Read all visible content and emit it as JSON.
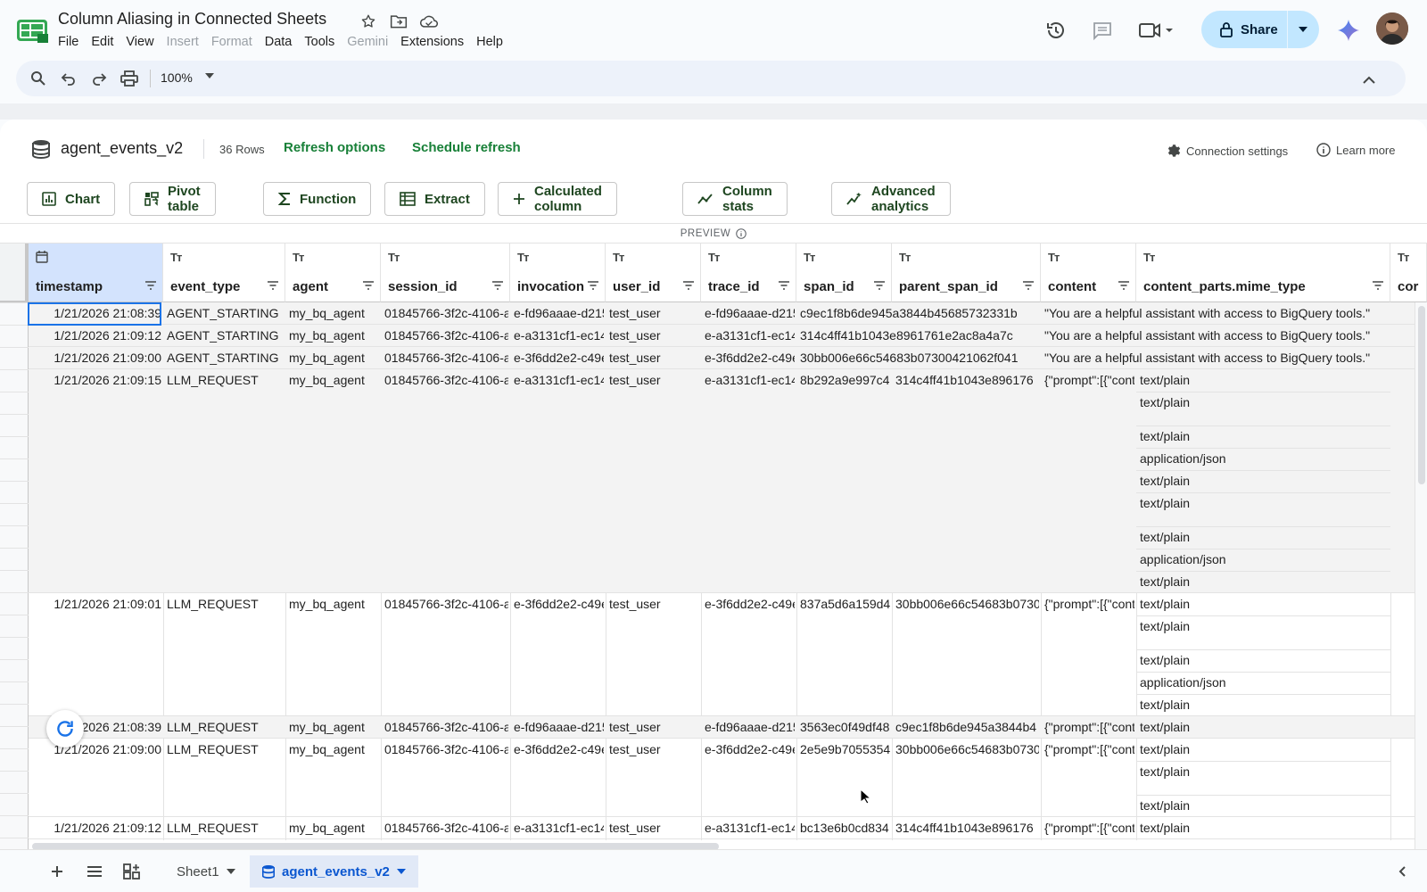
{
  "app": {
    "doc_title": "Column Aliasing in Connected Sheets",
    "menus": [
      {
        "label": "File",
        "disabled": false
      },
      {
        "label": "Edit",
        "disabled": false
      },
      {
        "label": "View",
        "disabled": false
      },
      {
        "label": "Insert",
        "disabled": true
      },
      {
        "label": "Format",
        "disabled": true
      },
      {
        "label": "Data",
        "disabled": false
      },
      {
        "label": "Tools",
        "disabled": false
      },
      {
        "label": "Gemini",
        "disabled": true
      },
      {
        "label": "Extensions",
        "disabled": false
      },
      {
        "label": "Help",
        "disabled": false
      }
    ],
    "share_label": "Share",
    "colors": {
      "accent": "#188038",
      "share_bg": "#c2e7ff",
      "selection": "#1a73e8"
    }
  },
  "toolbar": {
    "zoom": "100%"
  },
  "datasource": {
    "name": "agent_events_v2",
    "rows": "36 Rows",
    "refresh_options": "Refresh options",
    "schedule_refresh": "Schedule refresh",
    "connection_settings": "Connection settings",
    "learn_more": "Learn more",
    "preview_label": "PREVIEW"
  },
  "actions": [
    {
      "label": "Chart",
      "icon": "chart-icon"
    },
    {
      "label": "Pivot table",
      "icon": "pivot-icon"
    },
    {
      "label": "Function",
      "icon": "sigma-icon"
    },
    {
      "label": "Extract",
      "icon": "table-icon"
    },
    {
      "label": "Calculated column",
      "icon": "plus-icon"
    },
    {
      "label": "Column stats",
      "icon": "stats-icon"
    },
    {
      "label": "Advanced analytics",
      "icon": "analytics-icon"
    }
  ],
  "columns": [
    {
      "name": "timestamp",
      "type": "calendar"
    },
    {
      "name": "event_type",
      "type": "Tт"
    },
    {
      "name": "agent",
      "type": "Tт"
    },
    {
      "name": "session_id",
      "type": "Tт"
    },
    {
      "name": "invocation",
      "type": "Tт"
    },
    {
      "name": "user_id",
      "type": "Tт"
    },
    {
      "name": "trace_id",
      "type": "Tт"
    },
    {
      "name": "span_id",
      "type": "Tт"
    },
    {
      "name": "parent_span_id",
      "type": "Tт"
    },
    {
      "name": "content",
      "type": "Tт"
    },
    {
      "name": "content_parts.mime_type",
      "type": "Tт"
    },
    {
      "name": "cor",
      "type": "Tт"
    }
  ],
  "rows": [
    {
      "timestamp": "1/21/2026 21:08:39",
      "event_type": "AGENT_STARTING",
      "agent": "my_bq_agent",
      "session_id": "01845766-3f2c-4106-a",
      "invocation": "e-fd96aaae-d215",
      "user_id": "test_user",
      "trace_id": "e-fd96aaae-d215",
      "span_id": "c9ec1f8b6de945a3844b45685732331b",
      "parent_span_id": "",
      "content": "\"You are a helpful assistant with access to BigQuery tools.\"",
      "mime": []
    },
    {
      "timestamp": "1/21/2026 21:09:12",
      "event_type": "AGENT_STARTING",
      "agent": "my_bq_agent",
      "session_id": "01845766-3f2c-4106-a",
      "invocation": "e-a3131cf1-ec14",
      "user_id": "test_user",
      "trace_id": "e-a3131cf1-ec14",
      "span_id": "314c4ff41b1043e8961761e2ac8a4a7c",
      "parent_span_id": "",
      "content": "\"You are a helpful assistant with access to BigQuery tools.\"",
      "mime": []
    },
    {
      "timestamp": "1/21/2026 21:09:00",
      "event_type": "AGENT_STARTING",
      "agent": "my_bq_agent",
      "session_id": "01845766-3f2c-4106-a",
      "invocation": "e-3f6dd2e2-c49e",
      "user_id": "test_user",
      "trace_id": "e-3f6dd2e2-c49e",
      "span_id": "30bb006e66c54683b07300421062f041",
      "parent_span_id": "",
      "content": "\"You are a helpful assistant with access to BigQuery tools.\"",
      "mime": []
    },
    {
      "timestamp": "1/21/2026 21:09:15",
      "event_type": "LLM_REQUEST",
      "agent": "my_bq_agent",
      "session_id": "01845766-3f2c-4106-a",
      "invocation": "e-a3131cf1-ec14",
      "user_id": "test_user",
      "trace_id": "e-a3131cf1-ec14",
      "span_id": "8b292a9e997c4",
      "parent_span_id": "314c4ff41b1043e896176",
      "content": "{\"prompt\":[{\"cont",
      "mime": [
        "text/plain",
        "text/plain",
        "text/plain",
        "application/json",
        "text/plain",
        "text/plain",
        "text/plain",
        "application/json",
        "text/plain"
      ]
    },
    {
      "timestamp": "1/21/2026 21:09:01",
      "event_type": "LLM_REQUEST",
      "agent": "my_bq_agent",
      "session_id": "01845766-3f2c-4106-a",
      "invocation": "e-3f6dd2e2-c49e",
      "user_id": "test_user",
      "trace_id": "e-3f6dd2e2-c49e",
      "span_id": "837a5d6a159d4",
      "parent_span_id": "30bb006e66c54683b0730",
      "content": "{\"prompt\":[{\"cont",
      "mime": [
        "text/plain",
        "text/plain",
        "text/plain",
        "application/json",
        "text/plain"
      ]
    },
    {
      "timestamp": "1/21/2026 21:08:39",
      "event_type": "LLM_REQUEST",
      "agent": "my_bq_agent",
      "session_id": "01845766-3f2c-4106-a",
      "invocation": "e-fd96aaae-d215",
      "user_id": "test_user",
      "trace_id": "e-fd96aaae-d215",
      "span_id": "3563ec0f49df48",
      "parent_span_id": "c9ec1f8b6de945a3844b4",
      "content": "{\"prompt\":[{\"cont",
      "mime": [
        "text/plain"
      ]
    },
    {
      "timestamp": "1/21/2026 21:09:00",
      "event_type": "LLM_REQUEST",
      "agent": "my_bq_agent",
      "session_id": "01845766-3f2c-4106-a",
      "invocation": "e-3f6dd2e2-c49e",
      "user_id": "test_user",
      "trace_id": "e-3f6dd2e2-c49e",
      "span_id": "2e5e9b7055354",
      "parent_span_id": "30bb006e66c54683b0730",
      "content": "{\"prompt\":[{\"cont",
      "mime": [
        "text/plain",
        "text/plain",
        "text/plain"
      ]
    },
    {
      "timestamp": "1/21/2026 21:09:12",
      "event_type": "LLM_REQUEST",
      "agent": "my_bq_agent",
      "session_id": "01845766-3f2c-4106-a",
      "invocation": "e-a3131cf1-ec14",
      "user_id": "test_user",
      "trace_id": "e-a3131cf1-ec14",
      "span_id": "bc13e6b0cd834",
      "parent_span_id": "314c4ff41b1043e896176",
      "content": "{\"prompt\":[{\"cont",
      "mime": [
        "text/plain"
      ]
    }
  ],
  "sheets": [
    {
      "label": "Sheet1",
      "active": false
    },
    {
      "label": "agent_events_v2",
      "active": true
    }
  ]
}
